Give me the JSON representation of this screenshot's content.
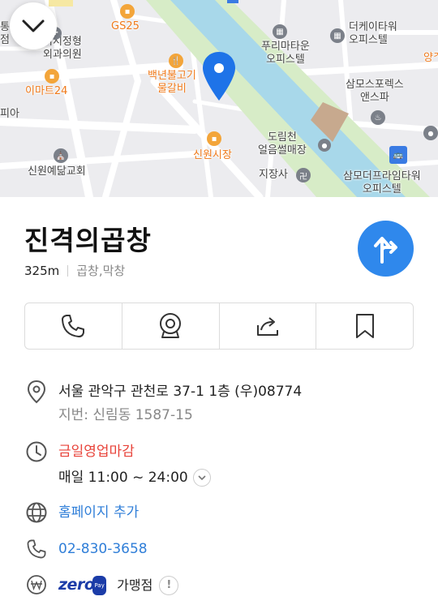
{
  "map": {
    "labels": {
      "top_left_edge": "통\n점",
      "clinic": "시지정형\n외과의원",
      "gs25": "GS25",
      "emart24": "이마트24",
      "pia": "피아",
      "church": "신원예닮교회",
      "restaurant": "백년불고기\n물갈비",
      "market": "신원시장",
      "puri": "푸리마타운\n오피스텔",
      "kt_tower": "더케이타워\n오피스텔",
      "yang": "양ᄌ",
      "samo_sports": "삼모스포렉스\n앤스파",
      "dorimcheon": "도림천\n얼음썰매장",
      "jijangsa": "지장사",
      "samo_prime": "삼모더프라임타워\n오피스텔"
    }
  },
  "place": {
    "name": "진격의곱창",
    "distance": "325m",
    "category": "곱창,막창"
  },
  "actions": [
    {
      "name": "call",
      "icon": "phone-icon"
    },
    {
      "name": "street-view",
      "icon": "camera-icon"
    },
    {
      "name": "share",
      "icon": "share-icon"
    },
    {
      "name": "save",
      "icon": "bookmark-icon"
    }
  ],
  "details": {
    "address": "서울 관악구 관천로 37-1 1층 (우)08774",
    "lot_address": "지번: 신림동 1587-15",
    "status": "금일영업마감",
    "hours": "매일 11:00 ~ 24:00",
    "homepage": "홈페이지 추가",
    "phone": "02-830-3658",
    "zero_logo": "zero",
    "zero_pay": "Pay",
    "zero_text": "가맹점",
    "zero_badge": "!"
  },
  "colors": {
    "accent": "#2f88ec",
    "closed": "#e8433a",
    "link": "#2f7ed8",
    "river": "#a8d8ea",
    "park": "#d7ecc7"
  }
}
